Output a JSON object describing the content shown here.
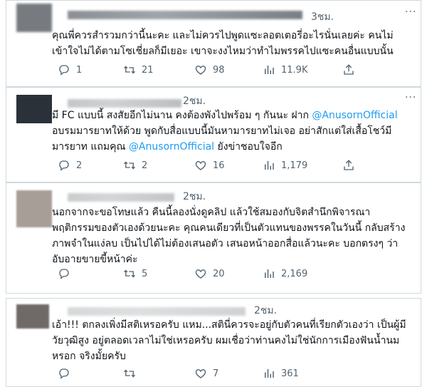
{
  "tweets": [
    {
      "time": "3ชม.",
      "text_parts": [
        "คุณพี่ควรสำรวมกว่านี้นะคะ และไม่ควรไปพูดแซะลอตเตอรี่อะไรนั่นเลยค่ะ คนไม่เข้าใจไม่ได้ตามโซเชี่ยลก็มีเยอะ เขาจะงงไหมว่าทำไมพรรคไปแซะคนอื่นแบบนั้น"
      ],
      "mentions": [],
      "replies": "1",
      "retweets": "21",
      "likes": "98",
      "views": "11.9K"
    },
    {
      "time": "2ชม.",
      "text_parts": [
        "มี FC แบบนี้ สงสัยอีกไม่นาน คงต้องพังไปพร้อม ๆ กันนะ ฝาก ",
        "@AnusornOfficial",
        " อบรมมารยาทให้ด้วย พูดกับสื่อแบบนี้มันหามารยาทไม่เจอ อย่าสักแต่ใส่เสื้อโชว์มีมารยาท แถมคุณ ",
        "@AnusornOfficial",
        " ยังข่าชอบใจอีก"
      ],
      "mentions": [
        "@AnusornOfficial"
      ],
      "replies": "2",
      "retweets": "2",
      "likes": "16",
      "views": "1,179"
    },
    {
      "time": "2ชม.",
      "text_parts": [
        "นอกจากจะขอโทษแล้ว คืนนี้ลองนั่งดูคลิป แล้วใช้สมองกับจิตสำนึกพิจารณาพฤติกรรมของตัวเองด้วยนะคะ คุณคนเดียวที่เป็นตัวแทนของพรรคในวันนี้ กลับสร้างภาพจำในแง่ลบ เป็นไปได้ไม่ต้องเสนอตัว เสนอหน้าออกสื่อแล้วนะคะ บอกตรงๆ ว่าอับอายขายขี้หน้าค่ะ"
      ],
      "mentions": [],
      "replies": "",
      "retweets": "5",
      "likes": "20",
      "views": "2,169"
    },
    {
      "time": "2ชม.",
      "text_parts": [
        "เอ้า!!! ตกลงเพิ่งมีสติเหรอครับ แหม...สตินี่ควรจะอยู่กับตัวคนที่เรียกตัวเองว่า เป็นผู้มีวัยวุฒิสูง อยู่ตลอดเวลาไม่ใช่เหรอครับ ผมเชื่อว่าท่านคงไม่ใช่นักการเมืองฟันน้ำนม หรอก จริงมั้ยครับ"
      ],
      "mentions": [],
      "replies": "",
      "retweets": "",
      "likes": "7",
      "views": "361"
    }
  ],
  "icons": {
    "reply": "reply-icon",
    "retweet": "retweet-icon",
    "like": "heart-icon",
    "views": "views-icon",
    "share": "share-icon"
  },
  "colors": {
    "mention": "#1d9bf0",
    "muted": "#536471",
    "border": "#cfd9de"
  }
}
